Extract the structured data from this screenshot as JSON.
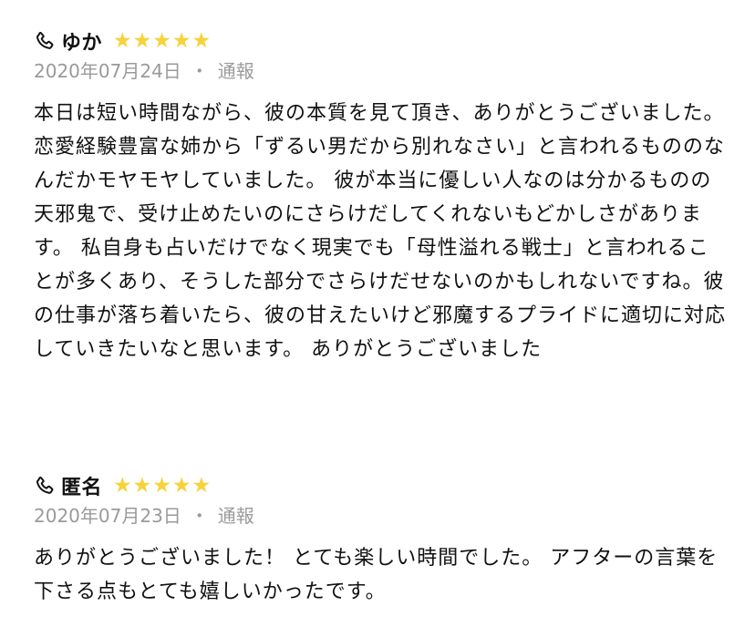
{
  "reviews": [
    {
      "name": "ゆか",
      "rating": 5,
      "date": "2020年07月24日",
      "separator": "・",
      "report_label": "通報",
      "body": "本日は短い時間ながら、彼の本質を見て頂き、ありがとうございました。 恋愛経験豊富な姉から「ずるい男だから別れなさい」と言われるもののなんだかモヤモヤしていました。 彼が本当に優しい人なのは分かるものの天邪鬼で、受け止めたいのにさらけだしてくれないもどかしさがあります。 私自身も占いだけでなく現実でも「母性溢れる戦士」と言われることが多くあり、そうした部分でさらけだせないのかもしれないですね。彼の仕事が落ち着いたら、彼の甘えたいけど邪魔するプライドに適切に対応していきたいなと思います。 ありがとうございました"
    },
    {
      "name": "匿名",
      "rating": 5,
      "date": "2020年07月23日",
      "separator": "・",
      "report_label": "通報",
      "body": "ありがとうございました！ とても楽しい時間でした。 アフターの言葉を下さる点もとても嬉しいかったです。"
    }
  ],
  "colors": {
    "star": "#f7d23a",
    "meta_text": "#9a9a9a",
    "body_text": "#111111"
  },
  "icons": {
    "header": "phone-icon",
    "rating": "star-icon"
  }
}
